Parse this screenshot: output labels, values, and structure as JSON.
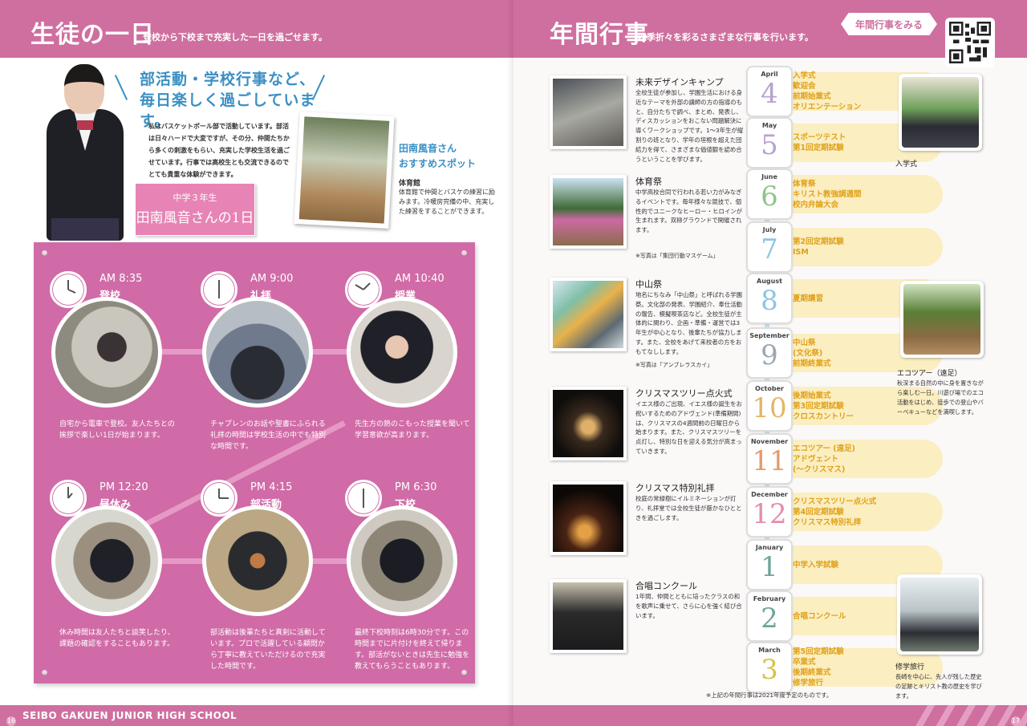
{
  "left_page": {
    "title": "生徒の一日",
    "subtitle": "登校から下校まで充実した一日を過ごせます。",
    "headline": [
      "部活動・学校行事など、",
      "毎日楽しく過ごしています。"
    ],
    "intro": "私はバスケットボール部で活動しています。部活は日々ハードで大変ですが、その分、仲間たちから多くの刺激をもらい、充実した学校生活を過ごせています。行事では高校生とも交流できるのでとても貴重な体験ができます。",
    "tag_line1": "中学３年生",
    "tag_line2": "田南風音さんの1日",
    "spot_title": [
      "田南風音さん",
      "おすすめスポット"
    ],
    "spot_place": "体育館",
    "spot_desc": "体育館で仲間とバスケの練習に励みます。冷暖房完備の中、充実した練習をすることができます。",
    "schedule": [
      {
        "time": "AM 8:35",
        "label": "登校",
        "desc": "自宅から電車で登校。友人たちとの挨拶で楽しい1日が始まります。"
      },
      {
        "time": "AM 9:00",
        "label": "礼拝",
        "desc": "チャプレンのお話や聖書にふられる礼拝の時間は学校生活の中でも特別な時間です。"
      },
      {
        "time": "AM 10:40",
        "label": "授業",
        "desc": "先生方の熱のこもった授業を聞いて学習意欲が高まります。"
      },
      {
        "time": "PM 12:20",
        "label": "昼休み",
        "desc": "休み時間は友人たちと談笑したり、課題の確認をすることもあります。"
      },
      {
        "time": "PM 4:15",
        "label": "部活動",
        "desc": "部活動は後輩たちと真剣に活動しています。プロで活躍している顧問から丁寧に教えていただけるので充実した時間です。"
      },
      {
        "time": "PM 6:30",
        "label": "下校",
        "desc": "最終下校時刻は6時30分です。この時間までに片付けを終えて帰ります。部活がないときは先生に勉強を教えてもらうこともあります。"
      }
    ],
    "footer": "SEIBO GAKUEN JUNIOR HIGH SCHOOL",
    "page_number": "16"
  },
  "right_page": {
    "title": "年間行事",
    "subtitle": "四季折々を彩るさまざまな行事を行います。",
    "qr_button": "年間行事をみる",
    "events": [
      {
        "name": "未来デザインキャンプ",
        "text": "全校生徒が参加し、学園生活における身近なテーマを外部の講師の方の指導のもと、自分たちで調べ、まとめ、発表し、ディスカッションをおこない問題解決に導くワークショップです。1～3年生が縦割りの班となり、学年の垣根を超えた団結力を得て、さまざまな価値観を認め合うということを学びます。",
        "note": ""
      },
      {
        "name": "体育祭",
        "text": "中学高校合同で行われる若い力がみなぎるイベントです。毎年様々な競技で、個性的でユニークなヒーロー・ヒロインが生まれます。双柳グラウンドで開催されます。",
        "note": "※写真は「集団行動マスゲーム」"
      },
      {
        "name": "中山祭",
        "text": "地名にちなみ「中山祭」と呼ばれる学園祭。文化部の発表、学園紹介、奉仕活動の報告、模擬喫茶店など。全校生徒が主体的に関わり、企画・準備・運営では3年生が中心となり、後輩たちが協力します。また、全校をあげて来校者の方をおもてなしします。",
        "note": "※写真は「アンブレラスカイ」"
      },
      {
        "name": "クリスマスツリー点火式",
        "text": "イエス様のご出現、イエス様の誕生をお祝いするためのアドヴェンド(準備期間)は、クリスマスの4週間前の日曜日から始まります。また、クリスマスツリーを点灯し、特別な日を迎える気分が高まっていきます。",
        "note": ""
      },
      {
        "name": "クリスマス特別礼拝",
        "text": "校庭の常緑樹にイルミネーションが灯り、礼拝堂では全校生徒が厳かなひとときを過ごします。",
        "note": ""
      },
      {
        "name": "合唱コンクール",
        "text": "1年間、仲間とともに培ったクラスの和を歌声に乗せて、さらに心を強く結び合います。",
        "note": ""
      }
    ],
    "months": [
      {
        "en": "April",
        "num": "4",
        "color": "#b9a1d1",
        "items": [
          "入学式",
          "歓迎会",
          "前期始業式",
          "オリエンテーション"
        ]
      },
      {
        "en": "May",
        "num": "5",
        "color": "#b9a1d1",
        "items": [
          "スポーツテスト",
          "第1回定期試験"
        ]
      },
      {
        "en": "June",
        "num": "6",
        "color": "#8fc48a",
        "items": [
          "体育祭",
          "キリスト教強調週間",
          "校内弁論大会"
        ]
      },
      {
        "en": "July",
        "num": "7",
        "color": "#8ec6e4",
        "items": [
          "第2回定期試験",
          "ISM"
        ]
      },
      {
        "en": "August",
        "num": "8",
        "color": "#8ec6e4",
        "items": [
          "夏期講習"
        ]
      },
      {
        "en": "September",
        "num": "9",
        "color": "#9aa6b0",
        "items": [
          "中山祭",
          "(文化祭)",
          "前期終業式"
        ]
      },
      {
        "en": "October",
        "num": "10",
        "color": "#e4b566",
        "items": [
          "後期始業式",
          "第3回定期試験",
          "クロスカントリー"
        ]
      },
      {
        "en": "November",
        "num": "11",
        "color": "#e69a6a",
        "items": [
          "エコツアー (遠足)",
          "アドヴェント",
          "(～クリスマス)"
        ]
      },
      {
        "en": "December",
        "num": "12",
        "color": "#e68dab",
        "items": [
          "クリスマスツリー点火式",
          "第4回定期試験",
          "クリスマス特別礼拝"
        ]
      },
      {
        "en": "January",
        "num": "1",
        "color": "#6ea59a",
        "items": [
          "中学入学試験"
        ]
      },
      {
        "en": "February",
        "num": "2",
        "color": "#6ea59a",
        "items": [
          "合唱コンクール"
        ]
      },
      {
        "en": "March",
        "num": "3",
        "color": "#d7c24a",
        "items": [
          "第5回定期試験",
          "卒業式",
          "後期終業式",
          "修学旅行"
        ]
      }
    ],
    "captions": {
      "nyugaku": "入学式",
      "eco_title": "エコツアー（遠足）",
      "eco_desc": "秋深まる自然の中に身を置きながら楽しむ一日。川遊び場でのエコ活動をはじめ、徒歩での登山やバーベキューなどを満喫します。",
      "trip_title": "修学旅行",
      "trip_desc": "長崎を中心に、先人が残した歴史の足跡とキリスト教の歴史を学びます。"
    },
    "footnote": "※上記の年間行事は2021年度予定のものです。",
    "page_number": "17"
  }
}
